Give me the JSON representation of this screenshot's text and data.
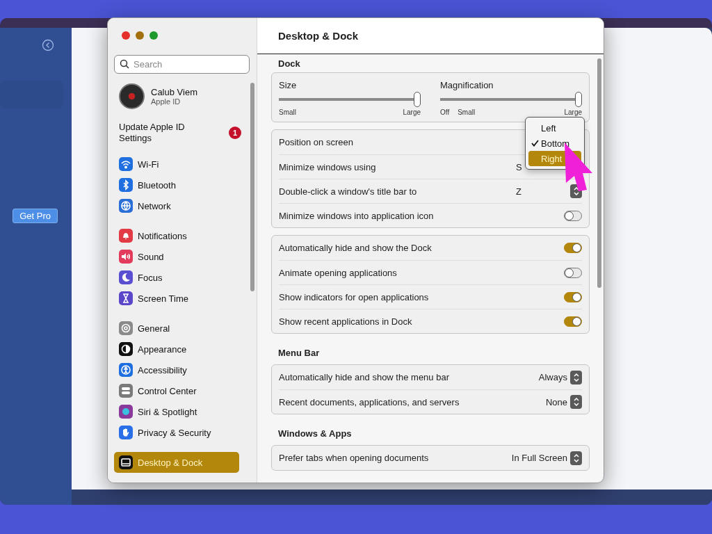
{
  "background_app": {
    "button": "Get Pro"
  },
  "window": {
    "title": "Desktop & Dock"
  },
  "sidebar": {
    "search": {
      "placeholder": "Search"
    },
    "account": {
      "name": "Calub Viem",
      "subtitle": "Apple ID"
    },
    "notice": {
      "label": "Update Apple ID Settings",
      "badge": "1"
    },
    "groups": [
      [
        {
          "label": "Wi-Fi",
          "selected": false
        },
        {
          "label": "Bluetooth",
          "selected": false
        },
        {
          "label": "Network",
          "selected": false
        }
      ],
      [
        {
          "label": "Notifications",
          "selected": false
        },
        {
          "label": "Sound",
          "selected": false
        },
        {
          "label": "Focus",
          "selected": false
        },
        {
          "label": "Screen Time",
          "selected": false
        }
      ],
      [
        {
          "label": "General",
          "selected": false
        },
        {
          "label": "Appearance",
          "selected": false
        },
        {
          "label": "Accessibility",
          "selected": false
        },
        {
          "label": "Control Center",
          "selected": false
        },
        {
          "label": "Siri & Spotlight",
          "selected": false
        },
        {
          "label": "Privacy & Security",
          "selected": false
        }
      ],
      [
        {
          "label": "Desktop & Dock",
          "selected": true
        }
      ]
    ]
  },
  "sections": [
    {
      "title": "Dock",
      "groups": [
        [
          {
            "kind": "sliders",
            "sliders": [
              {
                "label": "Size",
                "level": 1,
                "ticks": [
                  "Small",
                  "Large"
                ]
              },
              {
                "label": "Magnification",
                "level": 1,
                "ticks": [
                  "Off",
                  "Small",
                  "Large"
                ]
              }
            ]
          }
        ],
        [
          {
            "kind": "popup",
            "label": "Position on screen",
            "menu": [
              {
                "label": "Left",
                "checked": false,
                "selected": false
              },
              {
                "label": "Bottom",
                "checked": true,
                "selected": false
              },
              {
                "label": "Right",
                "checked": false,
                "selected": true
              }
            ]
          },
          {
            "kind": "popup",
            "label": "Minimize windows using",
            "value": "S"
          },
          {
            "kind": "popup",
            "label": "Double-click a window's title bar to",
            "value": "Z"
          },
          {
            "kind": "toggle",
            "label": "Minimize windows into application icon",
            "on": false
          }
        ],
        [
          {
            "kind": "toggle",
            "label": "Automatically hide and show the Dock",
            "on": true
          },
          {
            "kind": "toggle",
            "label": "Animate opening applications",
            "on": false
          },
          {
            "kind": "toggle",
            "label": "Show indicators for open applications",
            "on": true
          },
          {
            "kind": "toggle",
            "label": "Show recent applications in Dock",
            "on": true
          }
        ]
      ]
    },
    {
      "title": "Menu Bar",
      "groups": [
        [
          {
            "kind": "popup",
            "label": "Automatically hide and show the menu bar",
            "value": "Always"
          },
          {
            "kind": "popup",
            "label": "Recent documents, applications, and servers",
            "value": "None"
          }
        ]
      ]
    },
    {
      "title": "Windows & Apps",
      "groups": [
        [
          {
            "kind": "popup",
            "label": "Prefer tabs when opening documents",
            "value": "In Full Screen"
          }
        ]
      ]
    }
  ]
}
